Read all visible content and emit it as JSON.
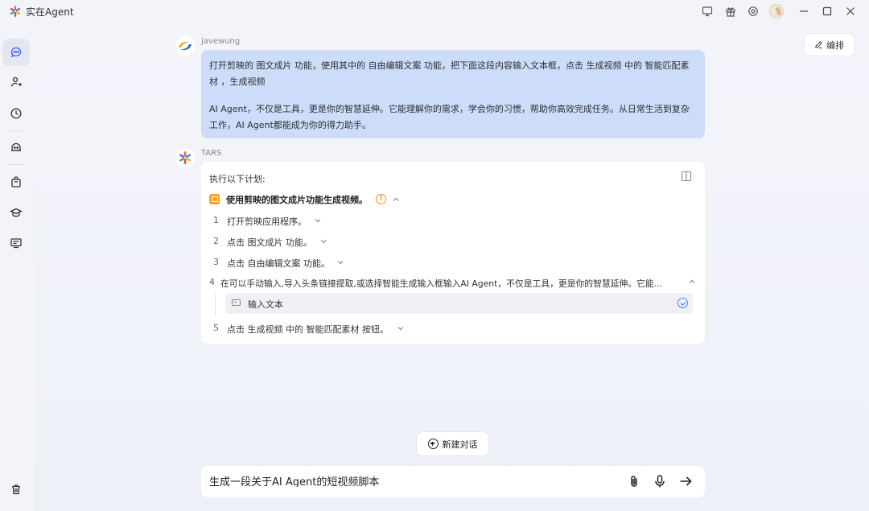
{
  "app": {
    "title": "实在Agent"
  },
  "titlebar": {
    "icons": [
      "monitor-icon",
      "gift-icon",
      "settings-icon",
      "avatar",
      "minimize-icon",
      "maximize-icon",
      "close-icon"
    ]
  },
  "sidebar": {
    "items": [
      {
        "name": "chat-icon",
        "active": true
      },
      {
        "name": "person-add-icon",
        "active": false
      },
      {
        "name": "history-icon",
        "active": false
      },
      {
        "name": "robot-icon",
        "active": false
      },
      {
        "name": "bag-icon",
        "active": false
      },
      {
        "name": "graduation-icon",
        "active": false
      },
      {
        "name": "message-list-icon",
        "active": false
      }
    ],
    "bottom": "trash-icon"
  },
  "toolbar": {
    "edit_label": "编排"
  },
  "conversation": {
    "user": {
      "name": "javewung",
      "paragraph1": "打开剪映的 图文成片 功能，使用其中的 自由编辑文案 功能，把下面这段内容输入文本框，点击 生成视频 中的 智能匹配素材 ，生成视频",
      "paragraph2": "AI Agent，不仅是工具，更是你的智慧延伸。它能理解你的需求，学会你的习惯，帮助你高效完成任务。从日常生活到复杂工作，AI Agent都能成为你的得力助手。"
    },
    "bot": {
      "name": "TARS",
      "plan_intro": "执行以下计划:",
      "task_title": "使用剪映的图文成片功能生成视频。",
      "steps": [
        {
          "num": "1",
          "text": "打开剪映应用程序。"
        },
        {
          "num": "2",
          "text": "点击 图文成片 功能。"
        },
        {
          "num": "3",
          "text": "点击 自由编辑文案 功能。"
        },
        {
          "num": "4",
          "text": "在可以手动输入,导入头条链接提取,或选择智能生成输入框输入AI Agent，不仅是工具，更是你的智慧延伸。它能..."
        },
        {
          "num": "5",
          "text": "点击 生成视频 中的 智能匹配素材 按钮。"
        }
      ],
      "substep": {
        "text": "输入文本"
      }
    }
  },
  "new_chat": {
    "label": "新建对话"
  },
  "input": {
    "value": "生成一段关于AI Agent的短视频脚本"
  },
  "colors": {
    "accent": "#4a5cff",
    "user_bubble": "#cddcf9",
    "warning": "#ff8a1a",
    "task_icon": "#ff9f1a"
  }
}
